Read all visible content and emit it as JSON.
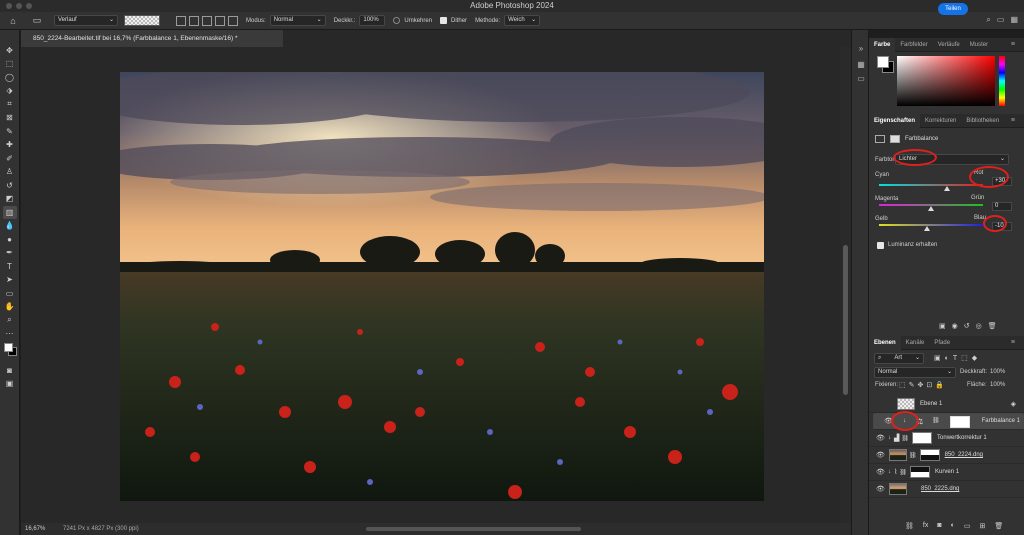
{
  "app": {
    "title": "Adobe Photoshop 2024"
  },
  "options_bar": {
    "preset_label": "Verlauf",
    "mode_label": "Modus:",
    "mode_value": "Normal",
    "opacity_label": "Deckkr.:",
    "opacity_value": "100%",
    "reverse_label": "Umkehren",
    "dither_label": "Dither",
    "method_label": "Methode:",
    "method_value": "Weich",
    "share_label": "Teilen"
  },
  "document": {
    "tab_title": "850_2224-Bearbeitet.tif bei 16,7% (Farbbalance 1, Ebenenmaske/16) *",
    "zoom": "16,67%",
    "info": "7241 Px x 4827 Px (300 ppi)"
  },
  "color_panel": {
    "tabs": [
      "Farbe",
      "Farbfelder",
      "Verläufe",
      "Muster"
    ],
    "active_tab": "Farbe"
  },
  "properties_panel": {
    "tabs": [
      "Eigenschaften",
      "Korrekturen",
      "Bibliotheken"
    ],
    "header": "Farbbalance",
    "tone_label": "Farbton",
    "tone_value": "Lichter",
    "sliders": [
      {
        "left": "Cyan",
        "right": "Rot",
        "value": "+30",
        "position": 0.65
      },
      {
        "left": "Magenta",
        "right": "Grün",
        "value": "0",
        "position": 0.5
      },
      {
        "left": "Gelb",
        "right": "Blau",
        "value": "-10",
        "position": 0.46
      }
    ],
    "preserve_luminosity": "Luminanz erhalten"
  },
  "layers_panel": {
    "tabs": [
      "Ebenen",
      "Kanäle",
      "Pfade"
    ],
    "filter_kind": "Art",
    "blend_mode": "Normal",
    "opacity_label": "Deckkraft:",
    "opacity_value": "100%",
    "lock_label": "Fixieren:",
    "fill_label": "Fläche:",
    "fill_value": "100%",
    "layers": [
      {
        "name": "Ebene 1",
        "visible": false,
        "selected": false
      },
      {
        "name": "Farbbalance 1",
        "visible": true,
        "selected": true
      },
      {
        "name": "Tonwertkorrektur 1",
        "visible": true,
        "selected": false
      },
      {
        "name": "850_2224.dng",
        "visible": true,
        "selected": false
      },
      {
        "name": "Kurven 1",
        "visible": true,
        "selected": false
      },
      {
        "name": "850_2225.dng",
        "visible": true,
        "selected": false
      }
    ]
  },
  "colors": {
    "accent": "#1473e6",
    "annotation": "#e0201c"
  }
}
